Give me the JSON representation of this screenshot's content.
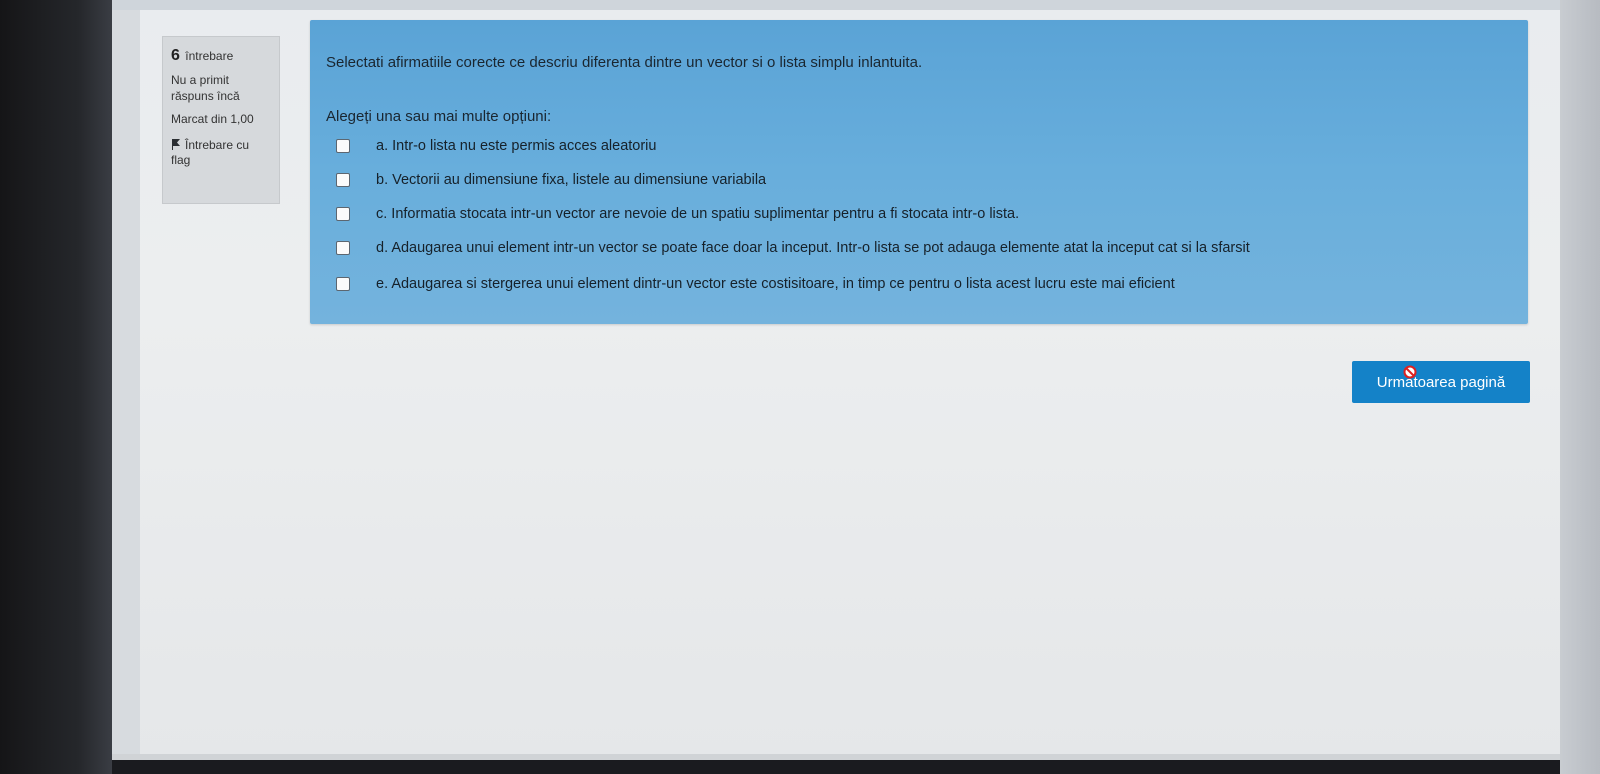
{
  "sidebar": {
    "question_number": "6",
    "question_word": "întrebare",
    "status": "Nu a primit răspuns încă",
    "marked": "Marcat din 1,00",
    "flag_label": "Întrebare cu flag",
    "flag_icon": "flag-icon"
  },
  "question": {
    "text": "Selectati afirmatiile corecte ce descriu diferenta dintre un vector si o lista simplu inlantuita.",
    "prompt": "Alegeți una sau mai multe opțiuni:",
    "options": [
      {
        "label": "a. Intr-o lista nu este permis acces aleatoriu",
        "checked": false
      },
      {
        "label": "b. Vectorii au dimensiune fixa, listele au dimensiune variabila",
        "checked": false
      },
      {
        "label": "c. Informatia stocata intr-un vector are nevoie de un spatiu suplimentar pentru a fi stocata intr-o lista.",
        "checked": false
      },
      {
        "label": "d. Adaugarea unui element intr-un vector se poate face doar la inceput. Intr-o lista se pot adauga elemente atat la inceput cat si la sfarsit",
        "checked": false
      },
      {
        "label": "e. Adaugarea si stergerea unui element dintr-un vector este costisitoare, in timp ce pentru o lista acest lucru este mai eficient",
        "checked": false
      }
    ]
  },
  "navigation": {
    "next_label": "Următoarea pagină"
  },
  "colors": {
    "panel": "#68aedc",
    "button": "#1482c8",
    "info_box": "#d6d9dc"
  }
}
